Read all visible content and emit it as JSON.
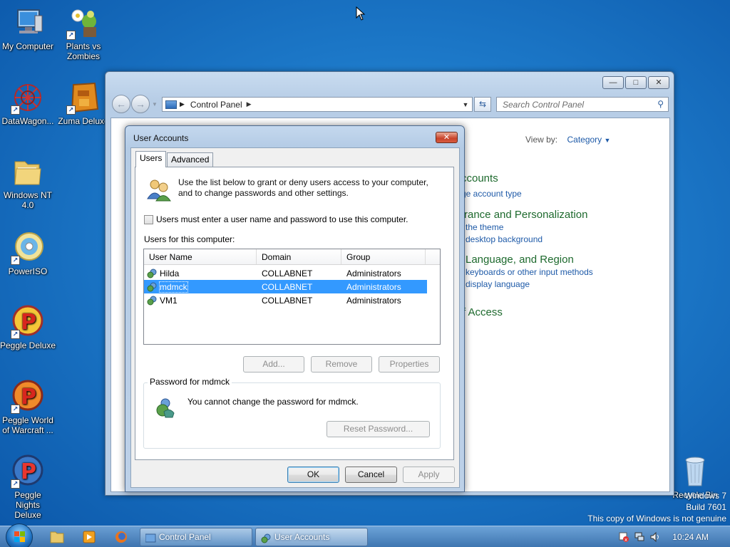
{
  "desktop": {
    "icons": [
      {
        "label": "My Computer",
        "icon": "computer-icon"
      },
      {
        "label": "Plants vs Zombies",
        "icon": "plants-vs-zombies-icon"
      },
      {
        "label": "DataWagon...",
        "icon": "datawagon-icon"
      },
      {
        "label": "Zuma Deluxe",
        "icon": "zuma-deluxe-icon"
      },
      {
        "label": "Windows NT 4.0",
        "icon": "folder-icon"
      },
      {
        "label": "PowerISO",
        "icon": "disc-icon"
      },
      {
        "label": "Peggle Deluxe",
        "icon": "peggle-icon"
      },
      {
        "label": "Peggle World of Warcraft ...",
        "icon": "peggle-icon"
      },
      {
        "label": "Peggle Nights Deluxe",
        "icon": "peggle-icon"
      },
      {
        "label": "Recycle Bin",
        "icon": "recycle-bin-icon"
      }
    ],
    "watermark": {
      "line1": "Windows 7",
      "line2": "Build 7601",
      "line3": "This copy of Windows is not genuine"
    }
  },
  "control_panel": {
    "address": "Control Panel",
    "search_placeholder": "Search Control Panel",
    "view_by_label": "View by:",
    "view_by_value": "Category",
    "headings": [
      "ccounts",
      "rance and Personalization",
      "Language, and Region",
      "f Access"
    ],
    "links": [
      "ge account type",
      "the theme",
      "desktop background",
      "keyboards or other input methods",
      "display language"
    ]
  },
  "dialog": {
    "title": "User Accounts",
    "tabs": [
      "Users",
      "Advanced"
    ],
    "intro_line1": "Use the list below to grant or deny users access to your computer,",
    "intro_line2": "and to change passwords and other settings.",
    "checkbox_label": "Users must enter a user name and password to use this computer.",
    "checkbox_checked": false,
    "users_label": "Users for this computer:",
    "columns": [
      "User Name",
      "Domain",
      "Group"
    ],
    "rows": [
      {
        "name": "Hilda",
        "domain": "COLLABNET",
        "group": "Administrators"
      },
      {
        "name": "mdmck",
        "domain": "COLLABNET",
        "group": "Administrators"
      },
      {
        "name": "VM1",
        "domain": "COLLABNET",
        "group": "Administrators"
      }
    ],
    "selected_row": 1,
    "add_label": "Add...",
    "remove_label": "Remove",
    "properties_label": "Properties",
    "password_group_label": "Password for mdmck",
    "password_message": "You cannot change the password for mdmck.",
    "reset_password_label": "Reset Password...",
    "ok_label": "OK",
    "cancel_label": "Cancel",
    "apply_label": "Apply"
  },
  "taskbar": {
    "tasks": [
      "Control Panel",
      "User Accounts"
    ],
    "clock": "10:24 AM"
  }
}
